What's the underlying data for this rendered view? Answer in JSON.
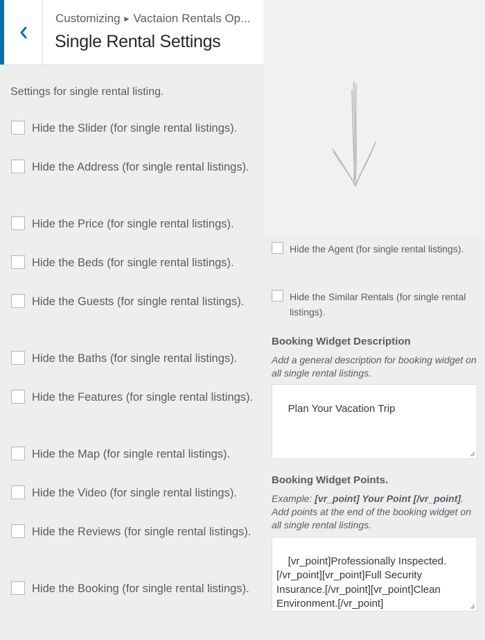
{
  "header": {
    "breadcrumb_root": "Customizing",
    "breadcrumb_section": "Vactaion Rentals Op...",
    "title": "Single Rental Settings"
  },
  "description": "Settings for single rental listing.",
  "left_options": [
    {
      "label": "Hide the Slider (for single rental listings).",
      "checked": false
    },
    {
      "label": "Hide the Address (for single rental listings).",
      "checked": false
    },
    {
      "label": "Hide the Price (for single rental listings).",
      "checked": false
    },
    {
      "label": "Hide the Beds (for single rental listings).",
      "checked": false
    },
    {
      "label": "Hide the Guests (for single rental listings).",
      "checked": false
    },
    {
      "label": "Hide the Baths (for single rental listings).",
      "checked": false
    },
    {
      "label": "Hide the Features (for single rental listings).",
      "checked": false
    },
    {
      "label": "Hide the Map (for single rental listings).",
      "checked": false
    },
    {
      "label": "Hide the Video (for single rental listings).",
      "checked": false
    },
    {
      "label": "Hide the Reviews (for single rental listings).",
      "checked": false
    },
    {
      "label": "Hide the Booking (for single rental listings).",
      "checked": false
    }
  ],
  "right_options": [
    {
      "label": "Hide the Agent (for single rental listings).",
      "checked": false
    },
    {
      "label": "Hide the Similar Rentals (for single rental listings).",
      "checked": false
    }
  ],
  "booking_description": {
    "title": "Booking Widget Description",
    "help": "Add a general description for booking widget on all single rental listings.",
    "value": "Plan Your Vacation Trip"
  },
  "booking_points": {
    "title": "Booking Widget Points.",
    "help_prefix": "Example: ",
    "help_example": "[vr_point] Your Point [/vr_point]",
    "help_suffix": ". Add points at the end of the booking widget on all single rental listings.",
    "value": "[vr_point]Professionally Inspected.\n[/vr_point][vr_point]Full Security\nInsurance.[/vr_point][vr_point]Clean\nEnvironment.[/vr_point]"
  },
  "colors": {
    "accent": "#0073aa",
    "panel_bg": "#eeeeee",
    "preview_bg": "#f1f1f1"
  },
  "icons": {
    "back": "chevron-left-icon",
    "separator": "triangle-right-icon",
    "resize": "resize-grip-icon"
  }
}
